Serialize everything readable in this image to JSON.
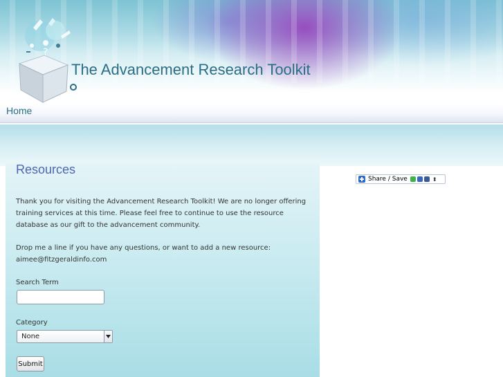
{
  "header": {
    "site_title": "The Advancement Research Toolkit",
    "logo_icon": "toolkit-cube-logo-icon"
  },
  "nav": {
    "items": [
      {
        "label": "Home"
      }
    ]
  },
  "main": {
    "title": "Resources",
    "paragraphs": [
      "Thank you for visiting the Advancement Research Toolkit! We are no longer offering training services at this time. Please feel free to continue to use the resource database as our gift to the advancement community.",
      "Drop me a line if you have any questions, or want to add a new resource: aimee@fitzgeraldinfo.com"
    ],
    "form": {
      "search_label": "Search Term",
      "search_value": "",
      "search_placeholder": "",
      "category_label": "Category",
      "category_selected": "None",
      "submit_label": "Submit"
    }
  },
  "share_widget": {
    "label": "Share / Save",
    "icons": [
      "share-plus-icon",
      "green-service-icon",
      "bookmark-service-icon",
      "facebook-icon",
      "expand-toggle-icon"
    ]
  },
  "colors": {
    "title_teal": "#2a6e86",
    "heading_blue": "#4c66b1",
    "content_gradient_top": "#e4f4f8",
    "content_gradient_bottom": "#a9dde6"
  }
}
